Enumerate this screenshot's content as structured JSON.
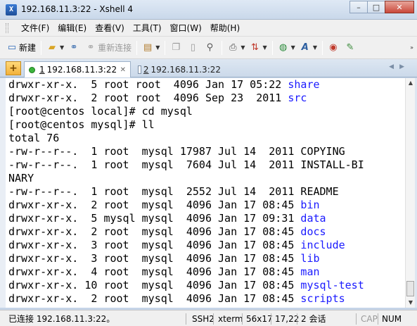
{
  "window": {
    "title": "192.168.11.3:22 - Xshell 4",
    "minimize": "–",
    "maximize": "□",
    "close": "✕"
  },
  "menu": [
    "文件(F)",
    "编辑(E)",
    "查看(V)",
    "工具(T)",
    "窗口(W)",
    "帮助(H)"
  ],
  "toolbar": {
    "new_label": "新建",
    "reconnect_label": "重新连接"
  },
  "tabs": {
    "active": {
      "number": "1",
      "label": "192.168.11.3:22"
    },
    "inactive": {
      "number": "2",
      "label": "192.168.11.3:22"
    }
  },
  "terminal": {
    "lines": [
      {
        "text": "drwxr-xr-x.  5 root root  4096 Jan 17 05:22 ",
        "name": "share"
      },
      {
        "text": "drwxr-xr-x.  2 root root  4096 Sep 23  2011 ",
        "name": "src"
      },
      {
        "text": "[root@centos local]# cd mysql",
        "name": ""
      },
      {
        "text": "[root@centos mysql]# ll",
        "name": ""
      },
      {
        "text": "total 76",
        "name": ""
      },
      {
        "text": "-rw-r--r--.  1 root  mysql 17987 Jul 14  2011 COPYING",
        "name": ""
      },
      {
        "text": "-rw-r--r--.  1 root  mysql  7604 Jul 14  2011 INSTALL-BI",
        "name": ""
      },
      {
        "text": "NARY",
        "name": ""
      },
      {
        "text": "-rw-r--r--.  1 root  mysql  2552 Jul 14  2011 README",
        "name": ""
      },
      {
        "text": "drwxr-xr-x.  2 root  mysql  4096 Jan 17 08:45 ",
        "name": "bin"
      },
      {
        "text": "drwxr-xr-x.  5 mysql mysql  4096 Jan 17 09:31 ",
        "name": "data"
      },
      {
        "text": "drwxr-xr-x.  2 root  mysql  4096 Jan 17 08:45 ",
        "name": "docs"
      },
      {
        "text": "drwxr-xr-x.  3 root  mysql  4096 Jan 17 08:45 ",
        "name": "include"
      },
      {
        "text": "drwxr-xr-x.  3 root  mysql  4096 Jan 17 08:45 ",
        "name": "lib"
      },
      {
        "text": "drwxr-xr-x.  4 root  mysql  4096 Jan 17 08:45 ",
        "name": "man"
      },
      {
        "text": "drwxr-xr-x. 10 root  mysql  4096 Jan 17 08:45 ",
        "name": "mysql-test"
      },
      {
        "text": "drwxr-xr-x.  2 root  mysql  4096 Jan 17 08:45 ",
        "name": "scripts"
      }
    ]
  },
  "status": {
    "connection": "已连接 192.168.11.3:22。",
    "protocol": "SSH2",
    "term": "xterm",
    "size": "56x17",
    "cursor": "17,22",
    "sessions": "2 会话",
    "caps": "CAP",
    "num": "NUM"
  },
  "colors": {
    "link_blue": "#1a1aff",
    "active_dot": "#3cb43c"
  }
}
